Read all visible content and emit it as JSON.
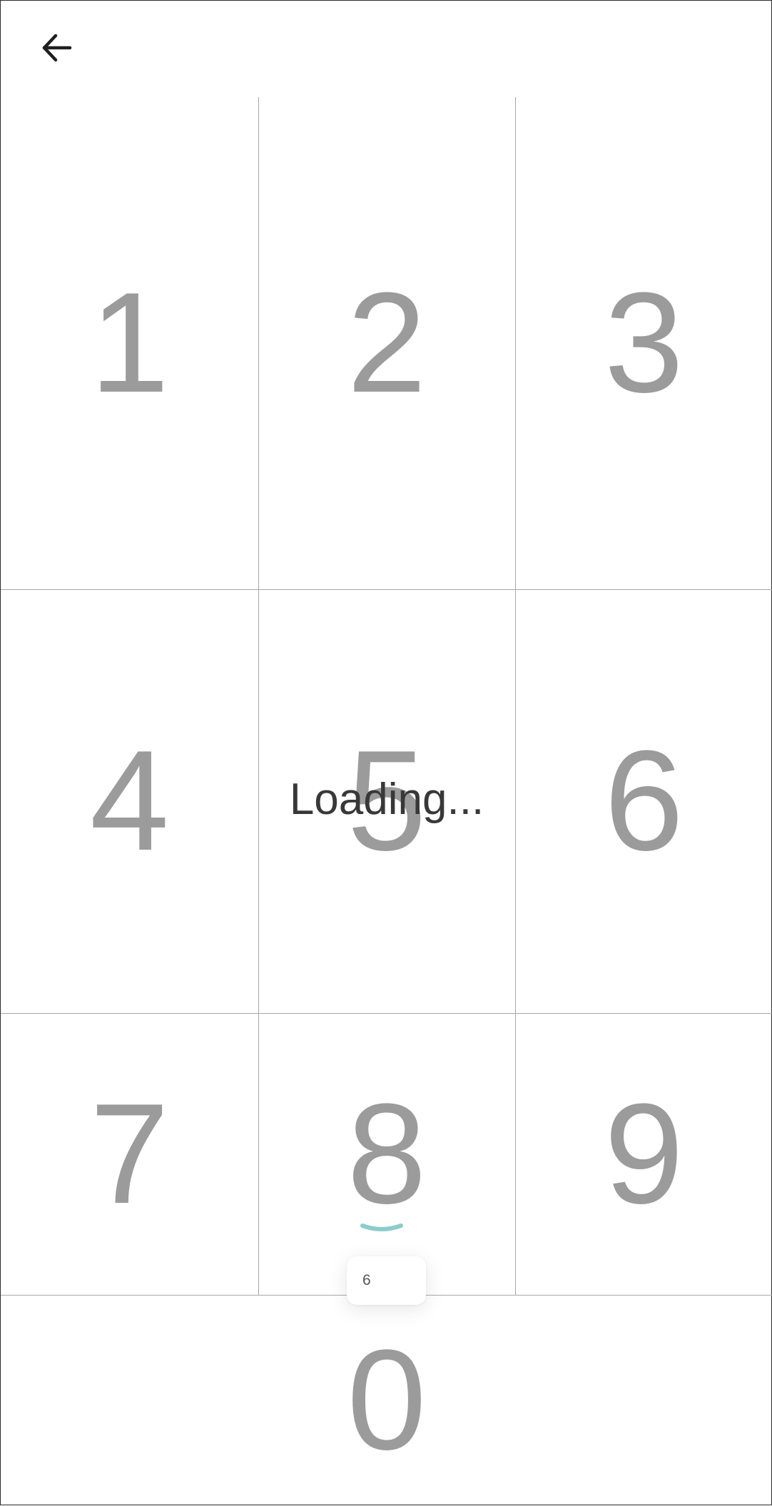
{
  "header": {
    "back_icon": "arrow-left-icon"
  },
  "keypad": {
    "keys": [
      "1",
      "2",
      "3",
      "4",
      "5",
      "6",
      "7",
      "8",
      "9",
      "0"
    ]
  },
  "status": {
    "loading_text": "Loading..."
  },
  "popup": {
    "value": "6"
  },
  "colors": {
    "key_text": "#9b9b9b",
    "grid_line": "#a7a7a7",
    "indicator": "#8ccccc",
    "loading_text": "#383838"
  }
}
